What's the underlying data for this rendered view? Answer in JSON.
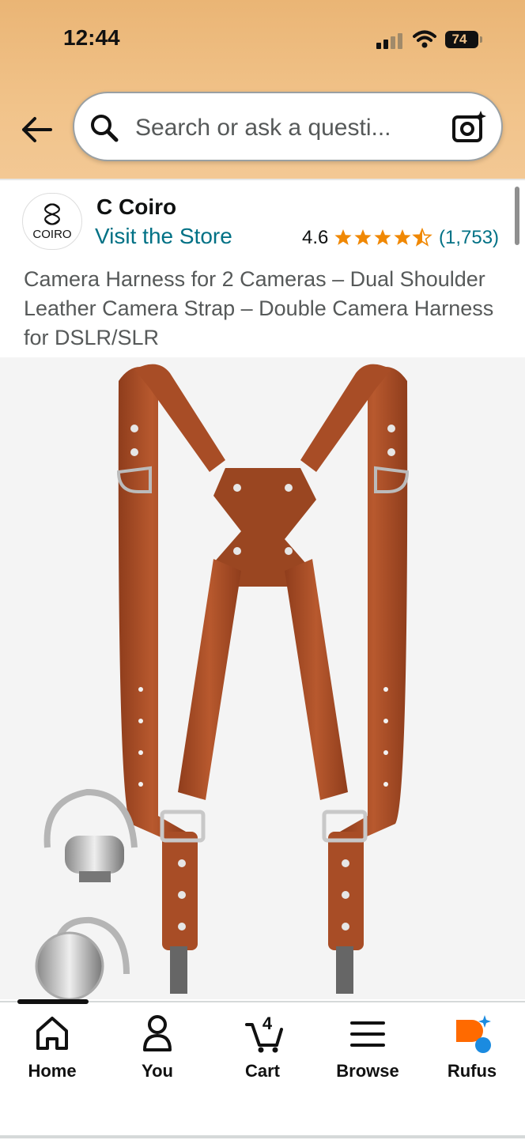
{
  "status_bar": {
    "time": "12:44",
    "battery": "74"
  },
  "search": {
    "placeholder": "Search or ask a questi..."
  },
  "brand": {
    "logo_text": "COIRO",
    "name": "C Coiro",
    "visit_store": "Visit the Store"
  },
  "rating": {
    "value": "4.6",
    "stars": 4.5,
    "count": "(1,753)"
  },
  "product": {
    "title": "Camera Harness for 2 Cameras – Dual Shoulder Leather Camera Strap – Double Camera Harness for DSLR/SLR"
  },
  "tabs": [
    {
      "label": "Home",
      "icon": "home-icon"
    },
    {
      "label": "You",
      "icon": "person-icon"
    },
    {
      "label": "Cart",
      "icon": "cart-icon",
      "badge": "4"
    },
    {
      "label": "Browse",
      "icon": "menu-icon"
    },
    {
      "label": "Rufus",
      "icon": "rufus-icon"
    }
  ],
  "colors": {
    "header_bg": "#f1c38a",
    "link": "#007185",
    "star": "#f08804",
    "leather": "#a94e28",
    "rufus_orange": "#ff6a00",
    "rufus_blue": "#1b8be0"
  }
}
